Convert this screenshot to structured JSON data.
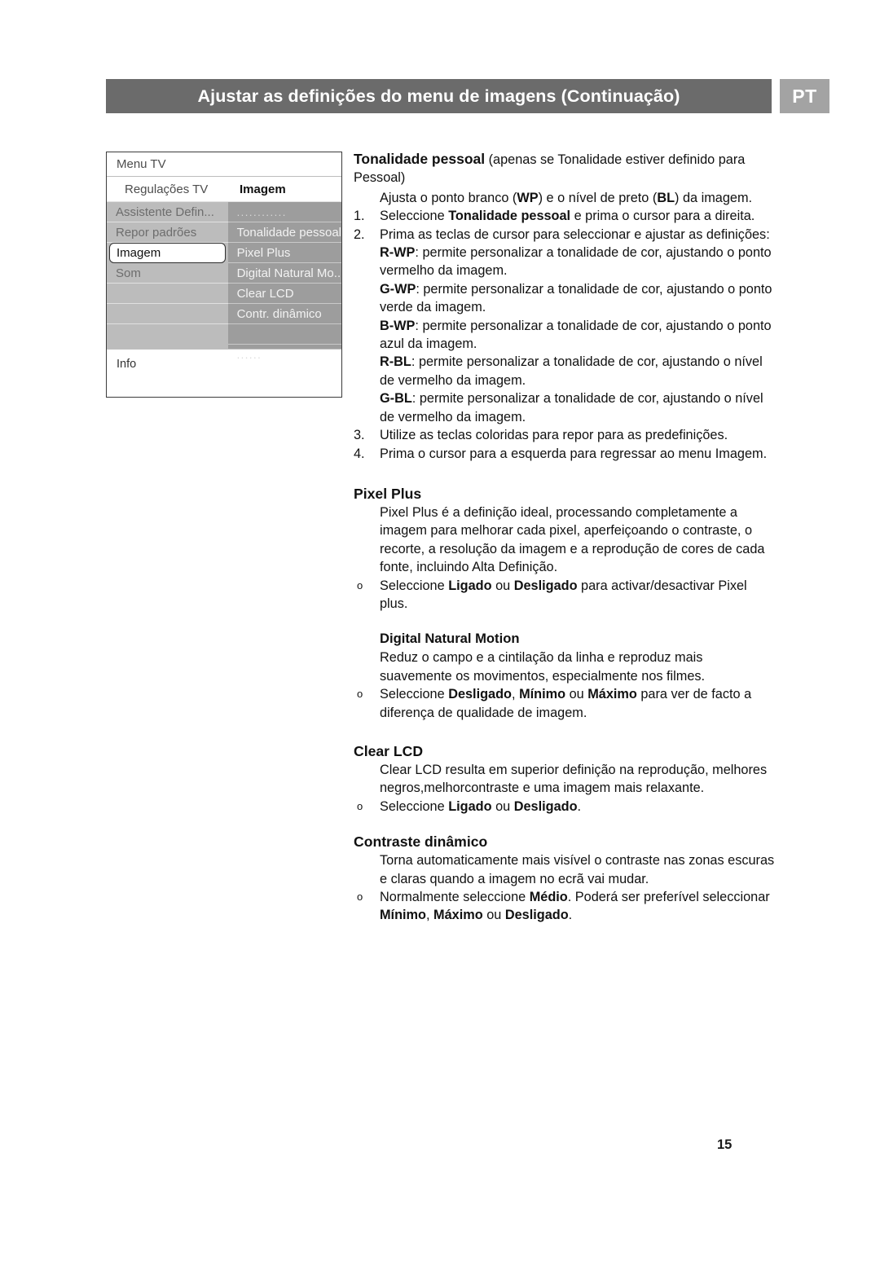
{
  "header": {
    "title": "Ajustar as definições do menu de imagens (Continuação)",
    "language_badge": "PT",
    "bar_color": "#6b6b6b",
    "badge_color": "#a3a3a3"
  },
  "tv_menu": {
    "title": "Menu TV",
    "subtitle_left": "Regulações TV",
    "subtitle_right": "Imagem",
    "left_column": [
      {
        "label": "Assistente Defin...",
        "selected": false
      },
      {
        "label": "Repor padrões",
        "selected": false
      },
      {
        "label": "Imagem",
        "selected": true
      },
      {
        "label": "Som",
        "selected": false
      },
      {
        "label": "",
        "selected": false
      },
      {
        "label": "",
        "selected": false
      },
      {
        "label": "",
        "selected": false
      }
    ],
    "right_column": [
      {
        "label": "............",
        "dots": true
      },
      {
        "label": "Tonalidade pessoal",
        "dots": false
      },
      {
        "label": "Pixel Plus",
        "dots": false
      },
      {
        "label": "Digital Natural Mo..",
        "dots": false
      },
      {
        "label": "Clear LCD",
        "dots": false
      },
      {
        "label": "Contr. dinâmico",
        "dots": false
      },
      {
        "label": "",
        "dots": false
      },
      {
        "label": "......",
        "dots": true
      }
    ],
    "footer": "Info"
  },
  "content": {
    "tonalidade": {
      "heading_bold": "Tonalidade pessoal",
      "heading_rest": " (apenas se Tonalidade estiver definido para Pessoal)",
      "intro_a": "Ajusta o ponto branco (",
      "intro_wp": "WP",
      "intro_b": ") e o nível de preto (",
      "intro_bl": "BL",
      "intro_c": ") da imagem.",
      "steps": [
        {
          "marker": "1.",
          "text_a": "Seleccione ",
          "bold": "Tonalidade pessoal",
          "text_b": " e prima o cursor para a direita."
        },
        {
          "marker": "2.",
          "text_a": "Prima as teclas de cursor para seleccionar e ajustar as definições:",
          "bold": "",
          "text_b": ""
        },
        {
          "marker": "3.",
          "text_a": "Utilize as teclas coloridas para repor para as predefinições.",
          "bold": "",
          "text_b": ""
        },
        {
          "marker": "4.",
          "text_a": "Prima o cursor para a esquerda para regressar ao menu Imagem.",
          "bold": "",
          "text_b": ""
        }
      ],
      "definitions": [
        {
          "key": "R-WP",
          "text": ": permite personalizar a tonalidade de cor, ajustando o ponto vermelho da imagem."
        },
        {
          "key": "G-WP",
          "text": ": permite personalizar a tonalidade de cor, ajustando o ponto verde da imagem."
        },
        {
          "key": "B-WP",
          "text": ": permite personalizar a tonalidade de cor, ajustando o ponto azul da imagem."
        },
        {
          "key": "R-BL",
          "text": ": permite personalizar a tonalidade de cor, ajustando o nível de vermelho da imagem."
        },
        {
          "key": "G-BL",
          "text": ": permite personalizar a tonalidade de cor, ajustando o nível de vermelho da imagem."
        }
      ]
    },
    "pixel_plus": {
      "heading": "Pixel Plus",
      "body": "Pixel Plus é a definição ideal, processando completamente a imagem para melhorar cada pixel, aperfeiçoando o contraste, o recorte, a resolução da imagem e a reprodução de cores de cada fonte, incluindo Alta Definição.",
      "bullet_marker": "o",
      "bullet_a": "Seleccione ",
      "bullet_b1": "Ligado",
      "bullet_mid": " ou ",
      "bullet_b2": "Desligado",
      "bullet_c": " para activar/desactivar Pixel plus."
    },
    "digital_natural_motion": {
      "heading": "Digital Natural Motion",
      "body": "Reduz o campo e a cintilação da linha e reproduz mais suavemente os movimentos, especialmente nos filmes.",
      "bullet_marker": "o",
      "bullet_a": "Seleccione ",
      "bullet_b1": "Desligado",
      "bullet_sep1": ", ",
      "bullet_b2": "Mínimo",
      "bullet_mid": " ou ",
      "bullet_b3": "Máximo",
      "bullet_c": " para ver de facto a diferença de qualidade de imagem."
    },
    "clear_lcd": {
      "heading": "Clear LCD",
      "body": "Clear LCD resulta em superior definição na reprodução, melhores negros,melhorcontraste e uma imagem mais relaxante.",
      "bullet_marker": "o",
      "bullet_a": "Seleccione ",
      "bullet_b1": "Ligado",
      "bullet_mid": " ou ",
      "bullet_b2": "Desligado",
      "bullet_c": "."
    },
    "contraste_dinamico": {
      "heading": "Contraste dinâmico",
      "body": "Torna automaticamente mais visível o contraste nas zonas escuras e claras quando a imagem no ecrã vai mudar.",
      "bullet_marker": "o",
      "bullet_a": "Normalmente seleccione ",
      "bullet_b1": "Médio",
      "bullet_mid1": ". Poderá ser preferível seleccionar ",
      "bullet_b2": "Mínimo",
      "bullet_sep": ", ",
      "bullet_b3": "Máximo",
      "bullet_mid2": " ou ",
      "bullet_b4": "Desligado",
      "bullet_end": "."
    }
  },
  "page_number": "15"
}
